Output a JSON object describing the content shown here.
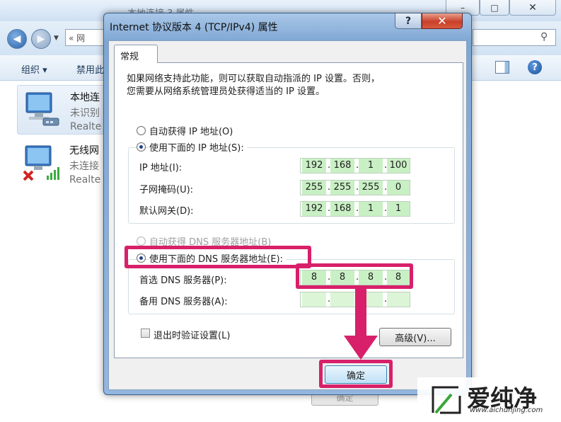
{
  "background_window": {
    "title": "本地连接 3 属性",
    "minimize": "–",
    "maximize": "□",
    "close": "✕",
    "address_text": "« 网",
    "toolbar": {
      "organize": "组织 ▾",
      "disable": "禁用此"
    },
    "help_icon_char": "?",
    "search_icon_char": "⚲",
    "connections": [
      {
        "name": "本地连",
        "status": "未识别",
        "device": "Realte"
      },
      {
        "name": "无线网",
        "status": "未连接",
        "device": "Realte"
      }
    ],
    "footer_button": "确定"
  },
  "dialog": {
    "title": "Internet 协议版本 4 (TCP/IPv4) 属性",
    "help_button": "?",
    "close_button": "✕",
    "tab_general": "常规",
    "description_line1": "如果网络支持此功能，则可以获取自动指派的 IP 设置。否则，",
    "description_line2": "您需要从网络系统管理员处获得适当的 IP 设置。",
    "ip": {
      "auto_label": "自动获得 IP 地址(O)",
      "manual_label": "使用下面的 IP 地址(S):",
      "selected": "manual",
      "fields": [
        {
          "label": "IP 地址(I):",
          "octets": [
            "192",
            "168",
            "1",
            "100"
          ]
        },
        {
          "label": "子网掩码(U):",
          "octets": [
            "255",
            "255",
            "255",
            "0"
          ]
        },
        {
          "label": "默认网关(D):",
          "octets": [
            "192",
            "168",
            "1",
            "1"
          ]
        }
      ]
    },
    "dns": {
      "auto_label": "自动获得 DNS 服务器地址(B)",
      "manual_label": "使用下面的 DNS 服务器地址(E):",
      "selected": "manual",
      "fields": [
        {
          "label": "首选 DNS 服务器(P):",
          "octets": [
            "8",
            "8",
            "8",
            "8"
          ]
        },
        {
          "label": "备用 DNS 服务器(A):",
          "octets": [
            "",
            "",
            "",
            ""
          ]
        }
      ]
    },
    "validate_label": "退出时验证设置(L)",
    "validate_checked": false,
    "advanced_button": "高级(V)...",
    "ok_button": "确定"
  },
  "annotations": {
    "highlight_color": "#d8206a"
  },
  "watermark": {
    "text": "爱纯净",
    "url": "www.aichunjing.com"
  }
}
